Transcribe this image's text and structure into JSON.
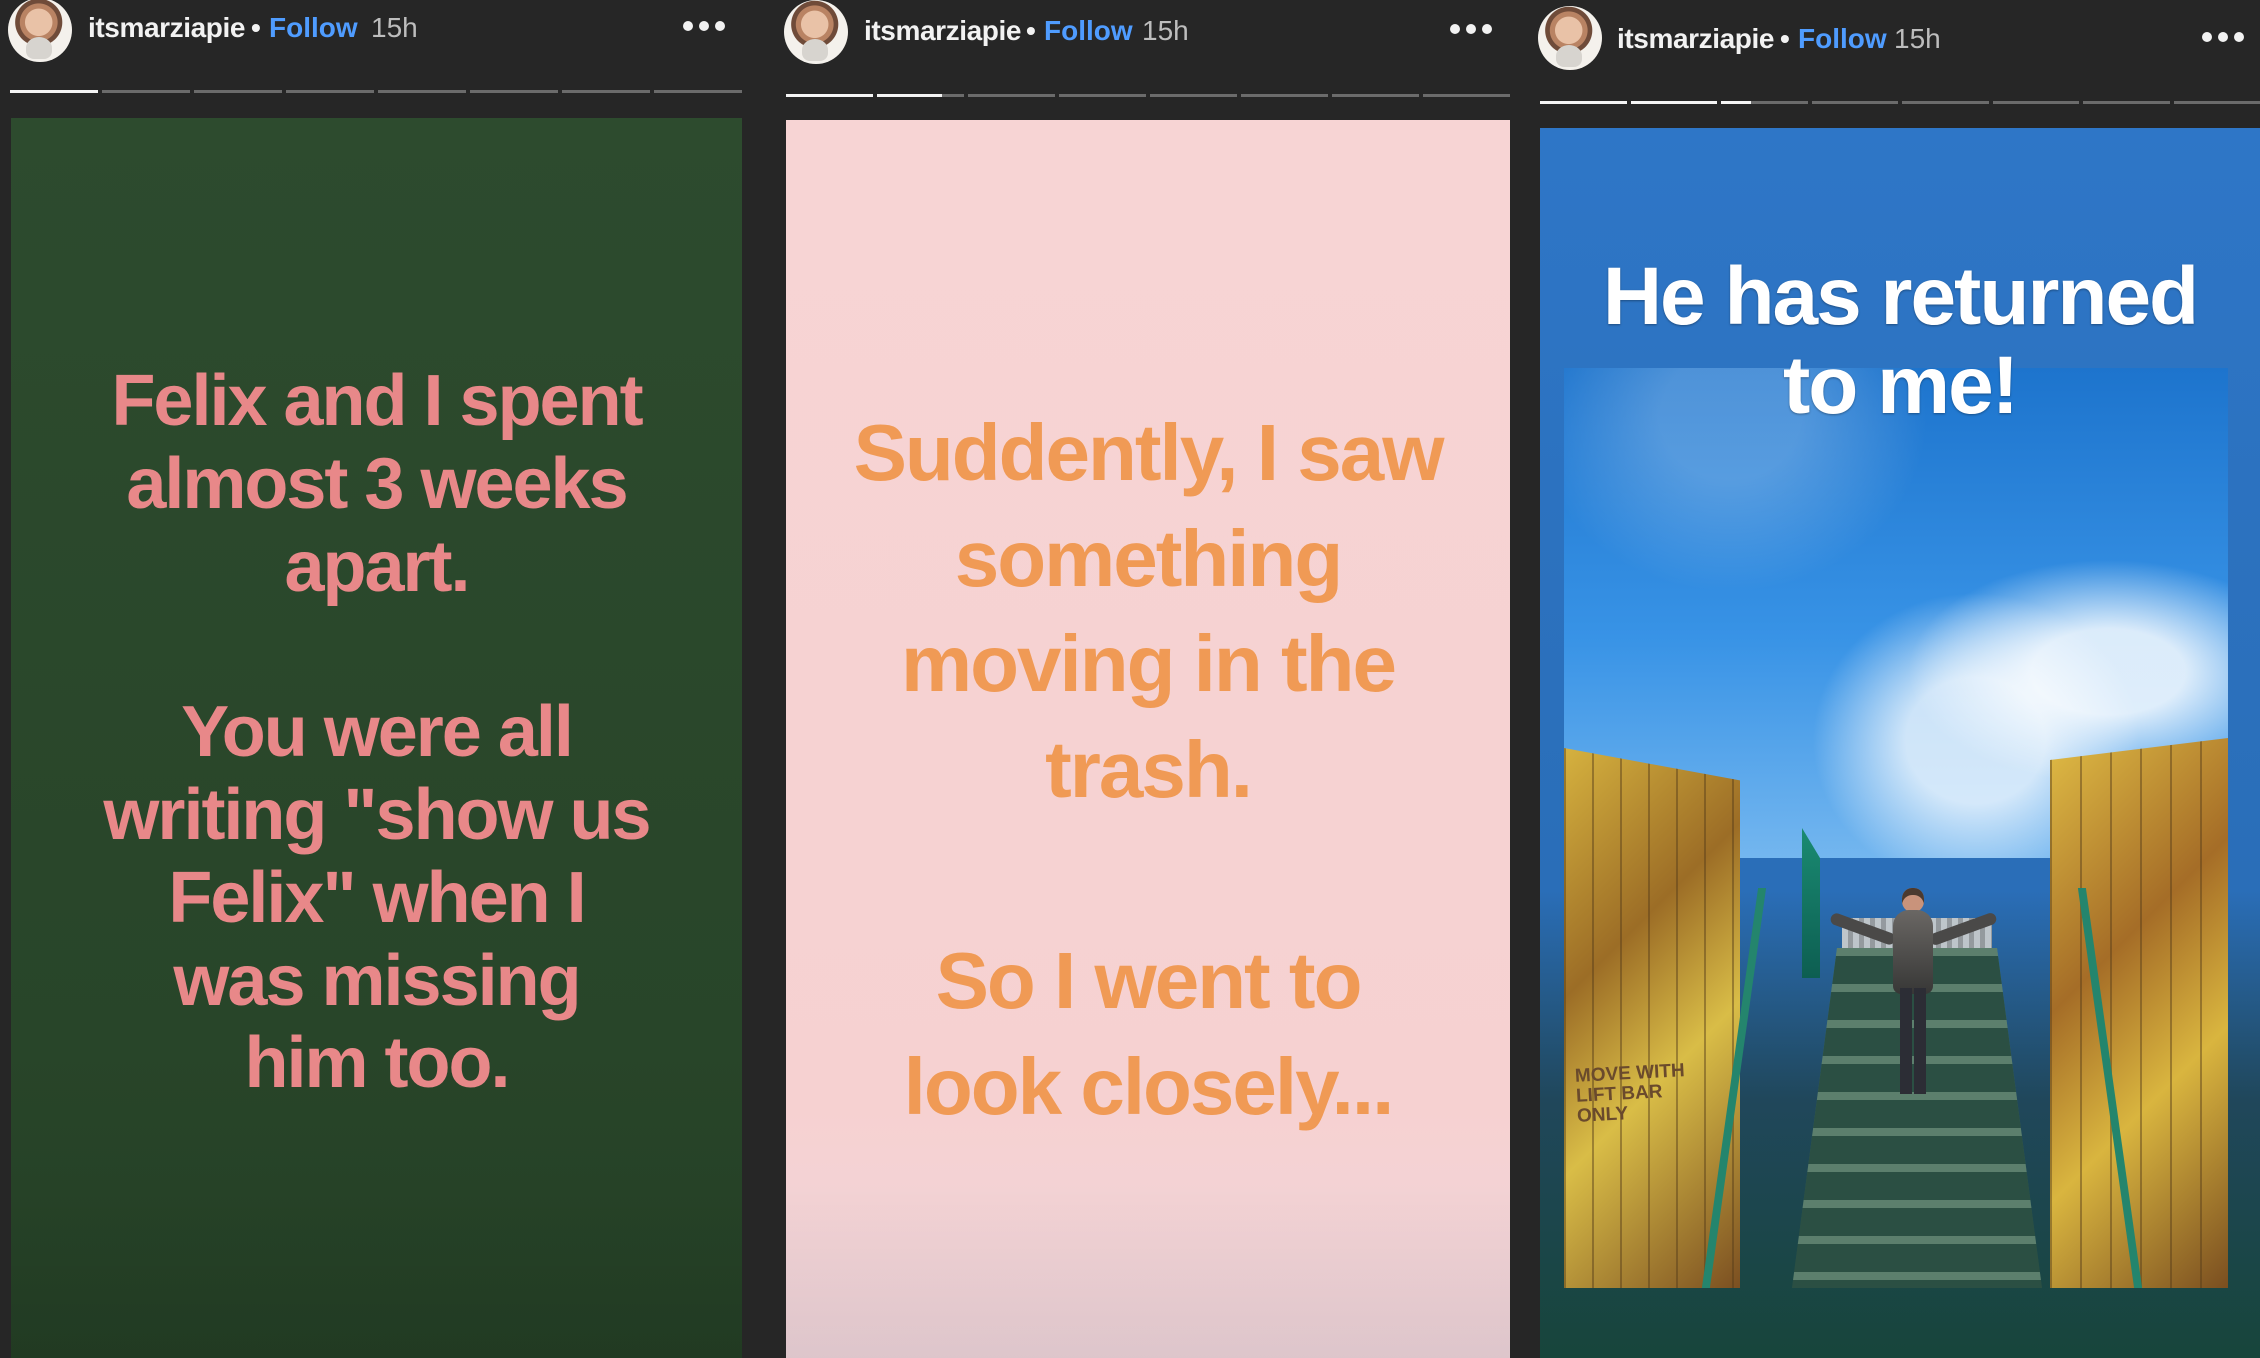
{
  "stories": [
    {
      "username": "itsmarziapie",
      "separator": "•",
      "follow_label": "Follow",
      "time": "15h",
      "more_icon": "more-horizontal-icon",
      "progress": [
        1,
        0,
        0,
        0,
        0,
        0,
        0,
        0
      ],
      "card_colors": {
        "background": "#2d4b2e",
        "text": "#e88889"
      },
      "text": "Felix and I spent\nalmost 3 weeks\napart.\n\nYou were all\nwriting \"show us\nFelix\" when I\nwas missing\nhim too."
    },
    {
      "username": "itsmarziapie",
      "separator": "•",
      "follow_label": "Follow",
      "time": "15h",
      "more_icon": "more-horizontal-icon",
      "progress": [
        1,
        0.75,
        0,
        0,
        0,
        0,
        0,
        0
      ],
      "card_colors": {
        "background": "#f7d4d4",
        "text": "#f09a55"
      },
      "text": "Suddently, I saw\nsomething\nmoving in the\ntrash.\n\nSo I went to\nlook closely..."
    },
    {
      "username": "itsmarziapie",
      "separator": "•",
      "follow_label": "Follow",
      "time": "15h",
      "more_icon": "more-horizontal-icon",
      "progress": [
        1,
        1,
        0.35,
        0,
        0,
        0,
        0,
        0
      ],
      "card_colors": {
        "background": "#2e76c7",
        "text": "#ffffff"
      },
      "text": "He has returned\nto me!",
      "photo": {
        "description_icon": "photo-icon",
        "sign_text": "MOVE WITH\nLIFT BAR\nONLY"
      }
    }
  ]
}
